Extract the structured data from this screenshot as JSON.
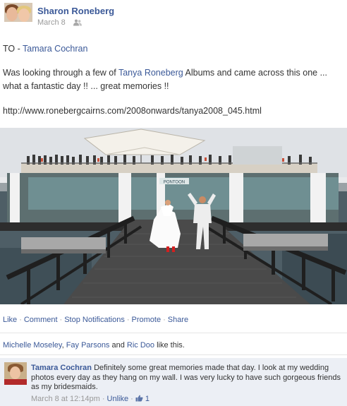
{
  "post": {
    "author": "Sharon Roneberg",
    "time": "March 8",
    "to_prefix": "TO - ",
    "to_name": "Tamara Cochran",
    "message_part1": "Was looking through a few of ",
    "message_link": "Tanya Roneberg",
    "message_part2": " Albums and came across this one ...",
    "message_line2": "what a fantastic day !! ... great memories !!",
    "url": "http://www.ronebergcairns.com/2008onwards/tanya2008_045.html",
    "photo_sign": "PONTOON"
  },
  "actions": {
    "like": "Like",
    "comment": "Comment",
    "stop_notifications": "Stop Notifications",
    "promote": "Promote",
    "share": "Share",
    "separator": "·"
  },
  "likes": {
    "name1": "Michelle Moseley",
    "comma": ", ",
    "name2": "Fay Parsons",
    "and": " and ",
    "name3": "Ric Doo",
    "suffix": " like this."
  },
  "comment": {
    "author": "Tamara Cochran",
    "text": "Definitely some great memories made that day. I look at my wedding photos every day as they hang on my wall. I was very lucky to have such gorgeous friends as my bridesmaids.",
    "time": "March 8 at 12:14pm",
    "separator": "·",
    "unlike": "Unlike",
    "like_count": "1"
  },
  "colors": {
    "link": "#3b5998",
    "text": "#333333",
    "meta": "#999999",
    "comment_bg": "#eceff5"
  },
  "icons": [
    "audience-friends-icon",
    "thumbs-up-icon"
  ]
}
